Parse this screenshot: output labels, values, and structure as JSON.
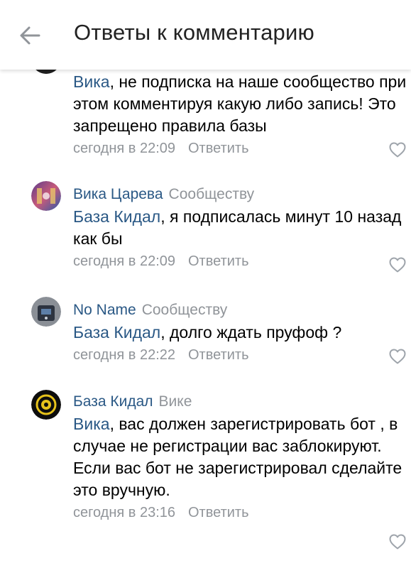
{
  "header": {
    "title": "Ответы к комментарию",
    "back_icon": "arrow-left-icon"
  },
  "colors": {
    "link": "#2a5885",
    "meta": "#909499",
    "text": "#000000"
  },
  "comments": [
    {
      "mention": "Вика",
      "text": ", не подписка на наше сообщество при этом комментируя какую либо запись! Это запрещено правила базы",
      "time": "сегодня в 22:09",
      "reply_label": "Ответить",
      "like_icon": "heart-outline-icon"
    },
    {
      "author": "Вика Царева",
      "reply_to": "Сообществу",
      "mention": "База Кидал",
      "text": ", я подписалась минут 10 назад как бы",
      "time": "сегодня в 22:09",
      "reply_label": "Ответить",
      "like_icon": "heart-outline-icon"
    },
    {
      "author": "No Name",
      "reply_to": "Сообществу",
      "mention": "База Кидал",
      "text": ", долго ждать пруфоф ?",
      "time": "сегодня в 22:22",
      "reply_label": "Ответить",
      "like_icon": "heart-outline-icon"
    },
    {
      "author": "База Кидал",
      "reply_to": "Вике",
      "mention": "Вика",
      "text": ", вас должен зарегистрировать бот , в случае не регистрации вас заблокируют. Если вас бот не зарегистрировал сделайте это вручную.",
      "time": "сегодня в 23:16",
      "reply_label": "Ответить",
      "like_icon": "heart-outline-icon"
    }
  ]
}
